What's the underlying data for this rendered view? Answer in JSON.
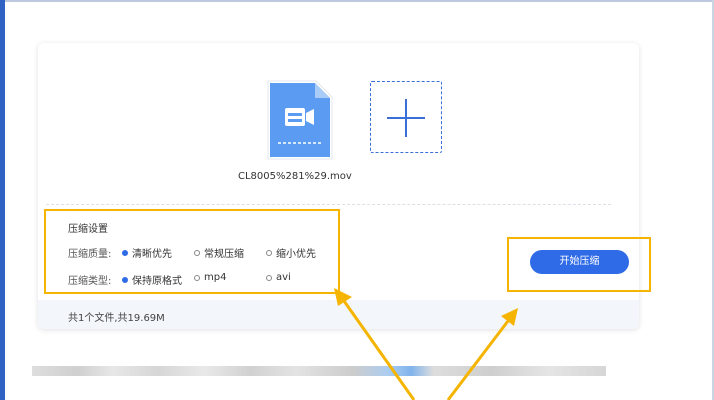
{
  "file": {
    "name": "CL8005%281%29.mov",
    "icon": "video-file-icon"
  },
  "add_icon": "plus-icon",
  "settings": {
    "title": "压缩设置",
    "quality": {
      "label": "压缩质量:",
      "options": [
        "清晰优先",
        "常规压缩",
        "缩小优先"
      ],
      "selected": "清晰优先"
    },
    "type": {
      "label": "压缩类型:",
      "options": [
        "保持原格式",
        "mp4",
        "avi"
      ],
      "selected": "保持原格式"
    }
  },
  "compress_button": {
    "label": "开始压缩"
  },
  "footer": {
    "summary": "共1个文件,共19.69M"
  },
  "colors": {
    "accent": "#2f6be6",
    "highlight": "#f5b400",
    "file_icon": "#5b9cf2"
  }
}
